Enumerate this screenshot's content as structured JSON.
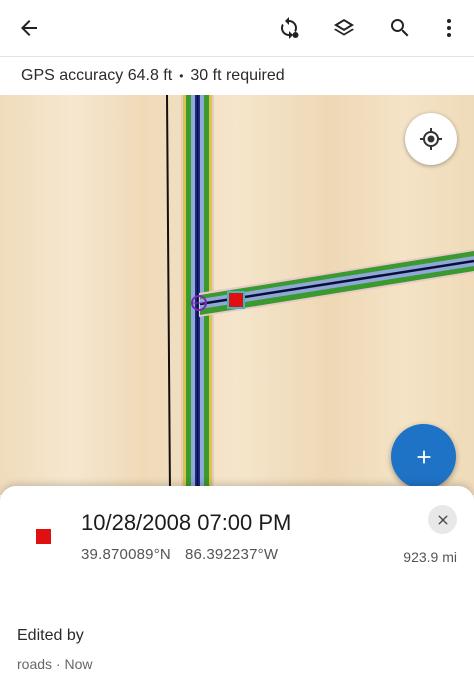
{
  "toolbar": {
    "back_icon": "arrow-left-icon",
    "sync_icon": "sync-icon",
    "layers_icon": "layers-icon",
    "search_icon": "search-icon",
    "more_icon": "more-vert-icon"
  },
  "gps": {
    "accuracy_text": "GPS accuracy 64.8 ft",
    "separator": "•",
    "required_text": "30 ft required"
  },
  "map": {
    "locate_icon": "locate-icon",
    "fab_icon": "plus-icon",
    "colors": {
      "background": "#f2dfc0",
      "road_fill": "#3a9a2e",
      "road_core": "#1b2a8a",
      "road_outline": "#e9c8c8",
      "highlight": "#d6c64a",
      "marker": "#e01010"
    }
  },
  "sheet": {
    "marker_color": "#e01010",
    "title": "10/28/2008 07:00 PM",
    "latitude": "39.870089°N",
    "longitude": "86.392237°W",
    "distance": "923.9 mi",
    "close_icon": "close-icon",
    "edited_by_label": "Edited by",
    "edited_meta": "roads · Now"
  }
}
